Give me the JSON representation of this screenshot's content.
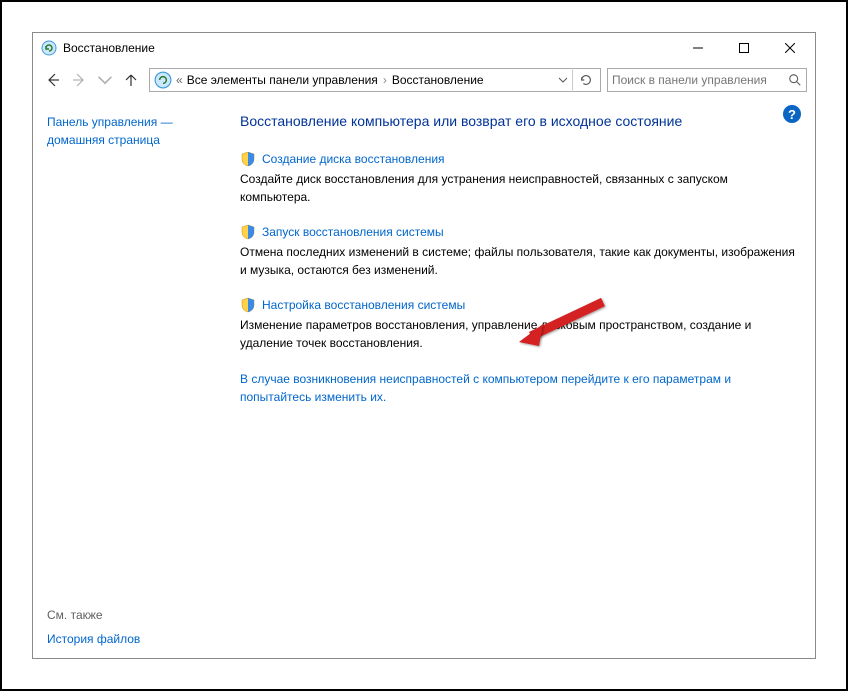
{
  "titlebar": {
    "title": "Восстановление"
  },
  "nav": {
    "breadcrumb_lead": "«",
    "crumb1": "Все элементы панели управления",
    "crumb2": "Восстановление"
  },
  "search": {
    "placeholder": "Поиск в панели управления"
  },
  "sidebar": {
    "home_link": "Панель управления — домашняя страница",
    "see_also": "См. также",
    "file_history": "История файлов"
  },
  "main": {
    "heading": "Восстановление компьютера или возврат его в исходное состояние",
    "opt1": {
      "title": "Создание диска восстановления",
      "desc": "Создайте диск восстановления для устранения неисправностей, связанных с запуском компьютера."
    },
    "opt2": {
      "title": "Запуск восстановления системы",
      "desc": "Отмена последних изменений в системе; файлы пользователя, такие как документы, изображения и музыка, остаются без изменений."
    },
    "opt3": {
      "title": "Настройка восстановления системы",
      "desc": "Изменение параметров восстановления, управление дисковым пространством, создание и удаление точек восстановления."
    },
    "troubleshoot": "В случае возникновения неисправностей с компьютером перейдите к его параметрам и попытайтесь изменить их."
  }
}
